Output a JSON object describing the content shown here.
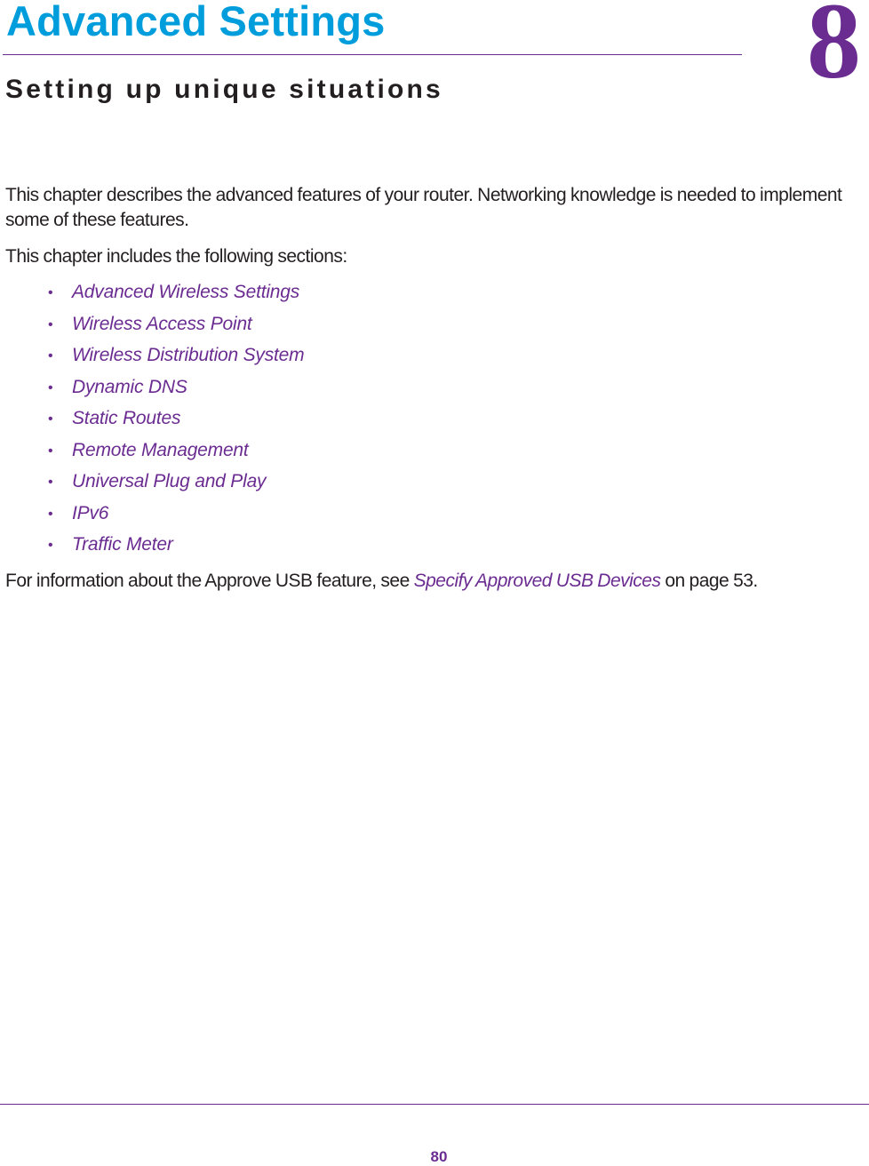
{
  "header": {
    "title": "Advanced Settings",
    "subtitle": "Setting up unique situations",
    "chapter_number": "8"
  },
  "intro": {
    "paragraph": "This chapter describes the advanced features of your router. Networking knowledge is needed to implement some of these features.",
    "includes": "This chapter includes the following sections:"
  },
  "sections": [
    {
      "label": "Advanced Wireless Settings"
    },
    {
      "label": "Wireless Access Point"
    },
    {
      "label": "Wireless Distribution System"
    },
    {
      "label": "Dynamic DNS"
    },
    {
      "label": "Static Routes"
    },
    {
      "label": "Remote Management"
    },
    {
      "label": "Universal Plug and Play"
    },
    {
      "label": "IPv6"
    },
    {
      "label": "Traffic Meter"
    }
  ],
  "footer_info": {
    "before": "For information about the Approve USB feature, see ",
    "link": "Specify Approved USB Devices",
    "after": " on page 53."
  },
  "page": {
    "number": "80"
  },
  "colors": {
    "title_blue": "#009ddc",
    "accent_purple": "#6b2c91",
    "text": "#231f20"
  },
  "bullet_glyph": "•"
}
